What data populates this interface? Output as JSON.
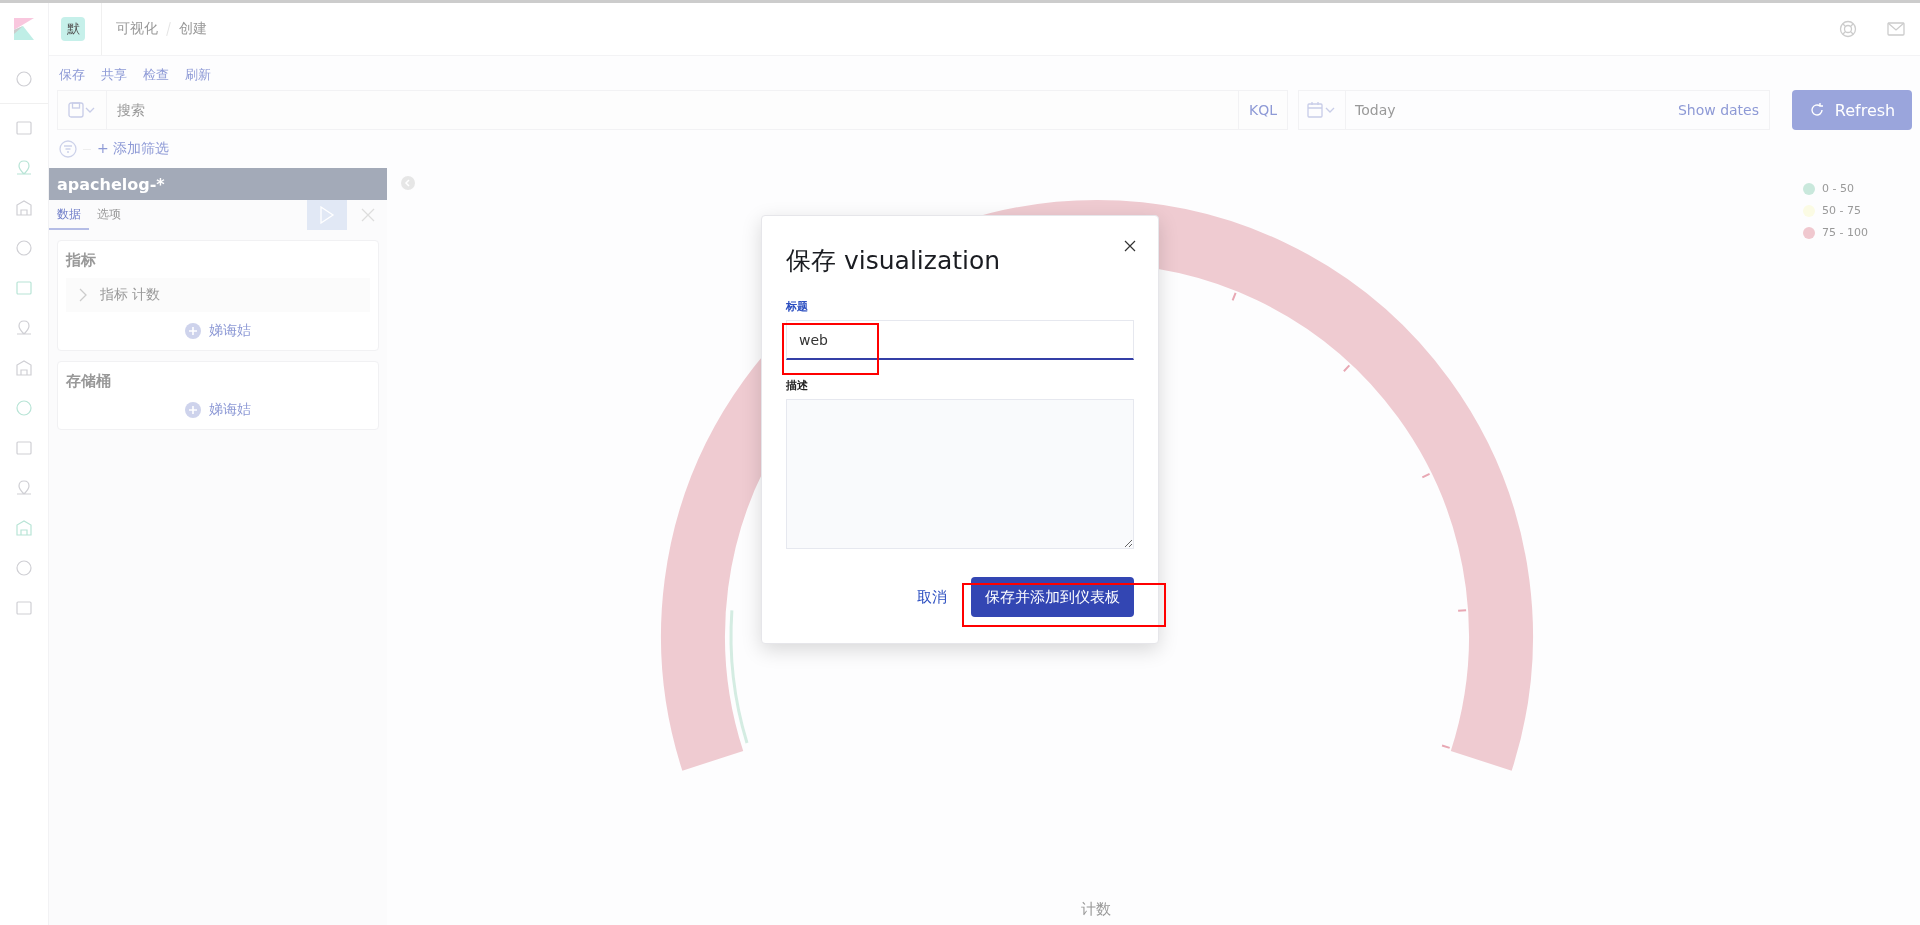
{
  "header": {
    "space_badge": "默",
    "breadcrumbs": [
      "可视化",
      "创建"
    ]
  },
  "top_menu": [
    "保存",
    "共享",
    "检查",
    "刷新"
  ],
  "query_bar": {
    "placeholder": "搜索",
    "language": "KQL",
    "date": "Today",
    "show_dates": "Show dates",
    "refresh": "Refresh"
  },
  "filter_bar": {
    "add_filter": "+ 添加筛选"
  },
  "editor": {
    "index_pattern": "apachelog-*",
    "tabs": [
      {
        "label": "数据",
        "selected": true
      },
      {
        "label": "选项",
        "selected": false
      }
    ],
    "sections": [
      {
        "title": "指标",
        "items": [
          {
            "label": "指标 计数",
            "expanded": false
          }
        ],
        "add": "娣诲姞"
      },
      {
        "title": "存储桶",
        "add": "娣诲姞"
      }
    ]
  },
  "chart": {
    "legend": [
      {
        "label": "0 - 50",
        "color": "#c9e8dc"
      },
      {
        "label": "50 - 75",
        "color": "#fbfbe4"
      },
      {
        "label": "75 - 100",
        "color": "#f0c8cf"
      }
    ],
    "axis_label": "计数"
  },
  "dialog": {
    "title": "保存 visualization",
    "title_label": "标题",
    "title_value": "web",
    "description_label": "描述",
    "cancel": "取消",
    "confirm": "保存并添加到仪表板"
  }
}
